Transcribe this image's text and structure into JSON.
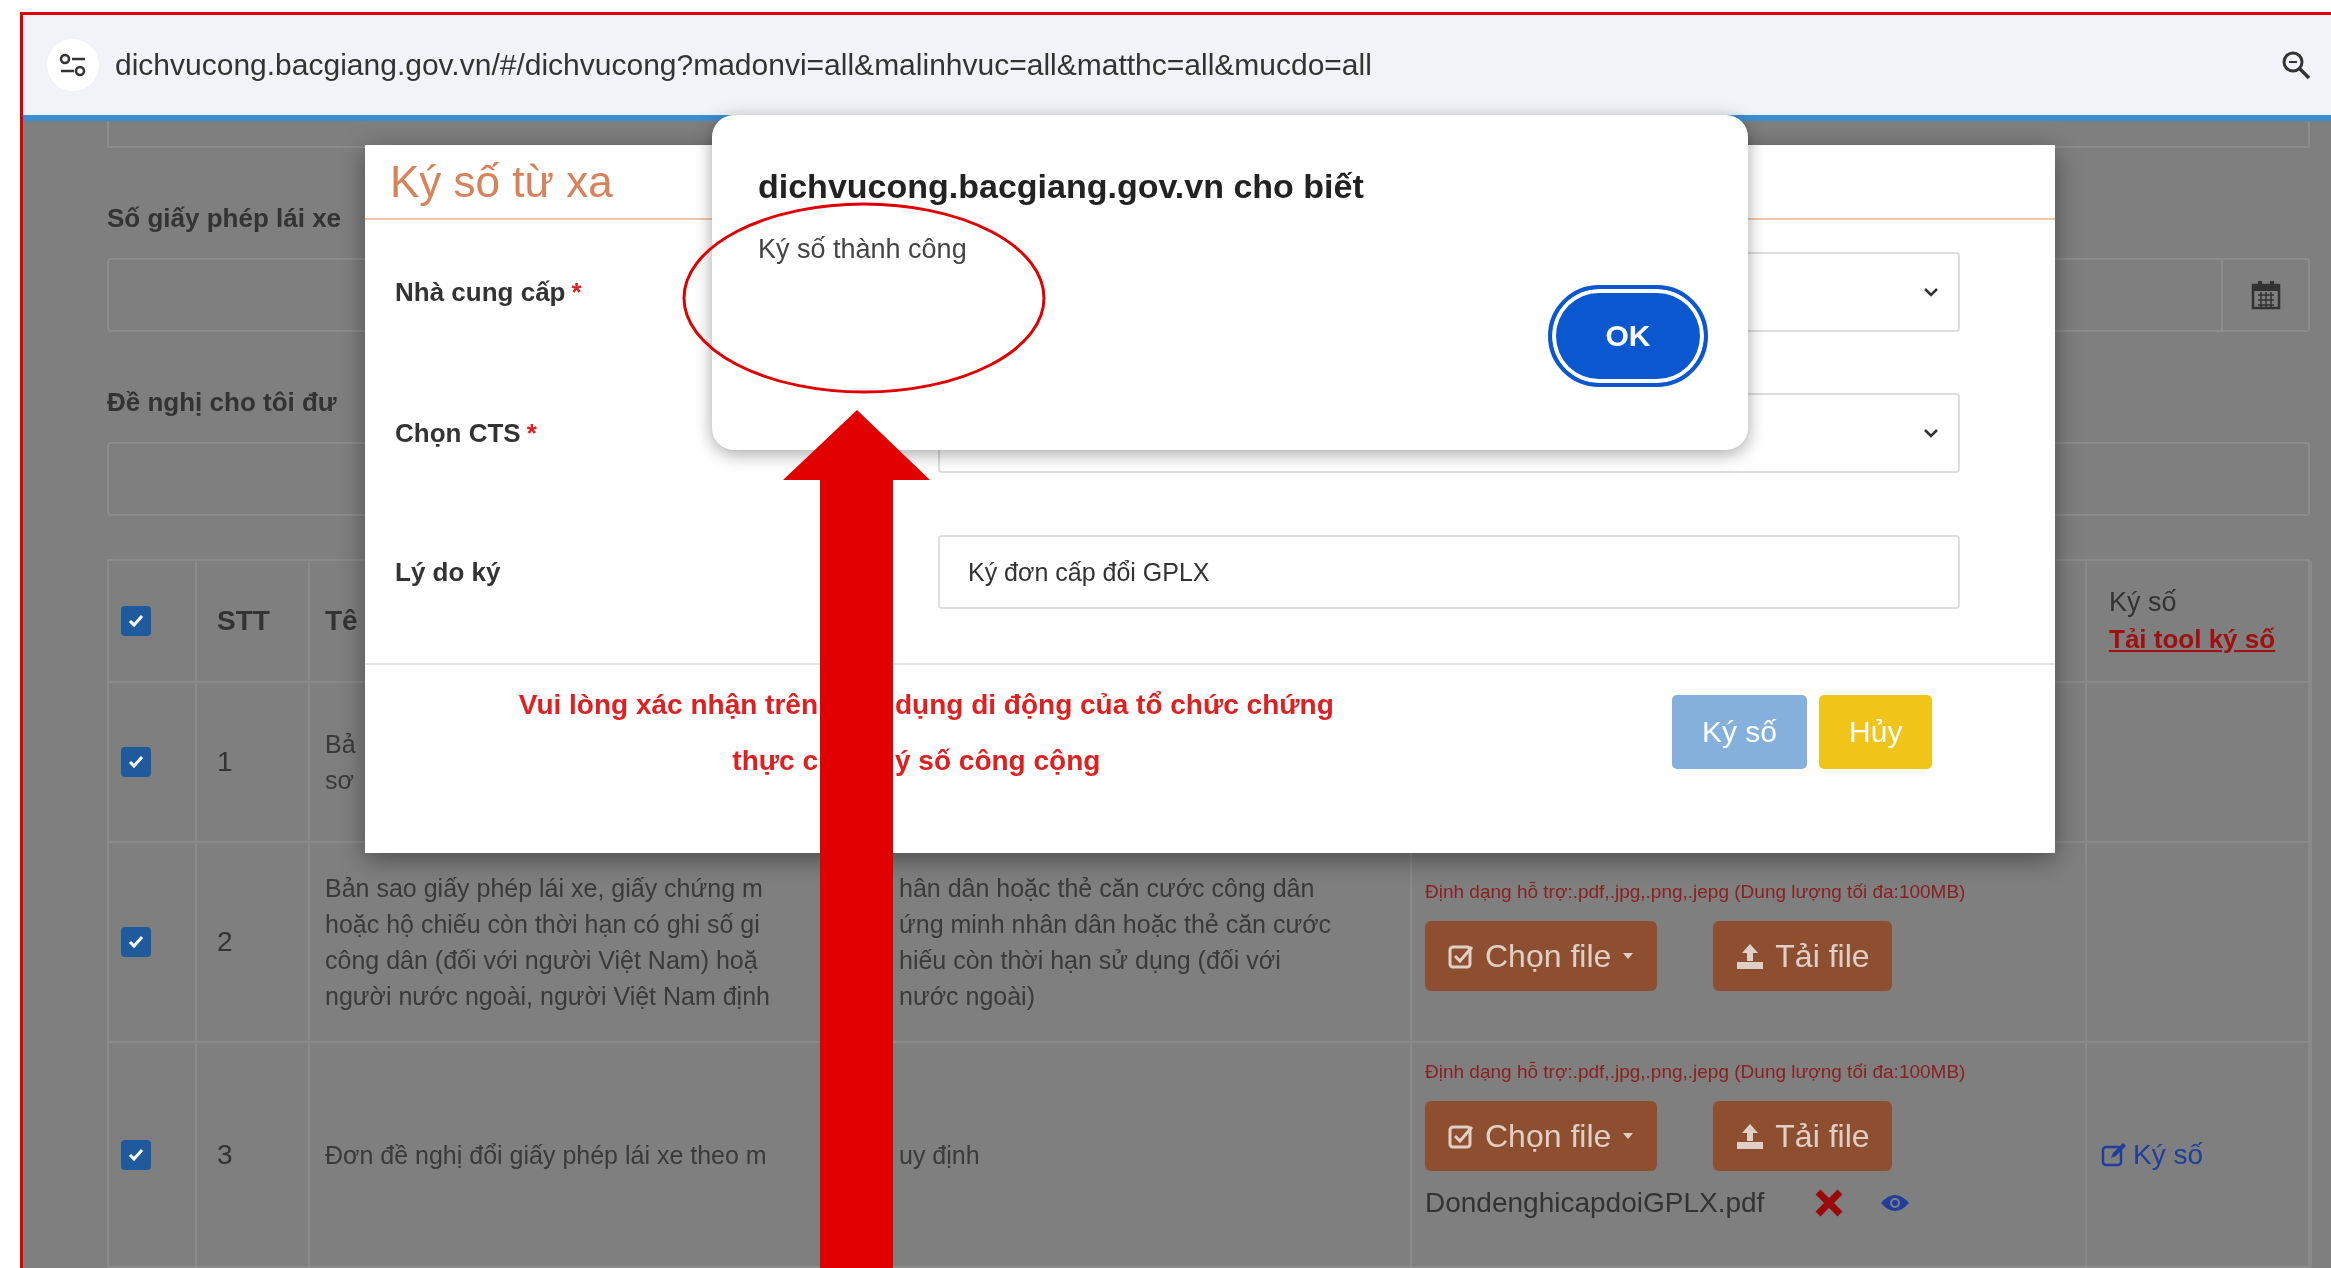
{
  "browser": {
    "url": "dichvucong.bacgiang.gov.vn/#/dichvucong?madonvi=all&malinhvuc=all&matthc=all&mucdo=all"
  },
  "form": {
    "fields": [
      {
        "label": "Số giấy phép lái xe",
        "kind": "date"
      },
      {
        "label": "Đề nghị cho tôi đư",
        "kind": "text"
      }
    ]
  },
  "table": {
    "header": {
      "checked": true,
      "number": "STT",
      "name": "Tê",
      "sign": "Ký số",
      "sign_link": "Tải tool ký số"
    },
    "rows": [
      {
        "checked": true,
        "number": "1",
        "name_lines": [
          [
            "Bả"
          ],
          [
            "sơ"
          ]
        ]
      },
      {
        "checked": true,
        "number": "2",
        "name_lines": [
          [
            "Bản sao giấy phép lái xe, giấy chứng m",
            "hân dân hoặc thẻ căn cước công dân"
          ],
          [
            "hoặc hộ chiếu còn thời hạn có ghi số gi",
            "ứng minh nhân dân hoặc thẻ căn cước"
          ],
          [
            "công dân (đối với người Việt Nam) hoặ",
            "hiếu còn thời hạn sử dụng (đối với"
          ],
          [
            "người nước ngoài, người Việt Nam định",
            "nước ngoài)"
          ]
        ],
        "files": {
          "hint": "Định dạng hỗ trợ:.pdf,.jpg,.png,.jepg (Dung lượng tối đa:100MB)",
          "choose": "Chọn file",
          "upload": "Tải file"
        }
      },
      {
        "checked": true,
        "number": "3",
        "name_lines": [
          [
            "Đơn đề nghị đổi giấy phép lái xe theo m",
            "uy định"
          ]
        ],
        "files": {
          "hint": "Định dạng hỗ trợ:.pdf,.jpg,.png,.jepg (Dung lượng tối đa:100MB)",
          "choose": "Chọn file",
          "upload": "Tải file",
          "file_name": "DondenghicapdoiGPLX.pdf"
        },
        "sign_link": "Ký số"
      }
    ]
  },
  "modal": {
    "title": "Ký số từ xa",
    "fields": [
      {
        "label": "Nhà cung cấp",
        "required_mark": "*",
        "kind": "select"
      },
      {
        "label": "Chọn CTS",
        "required_mark": "*",
        "kind": "select"
      },
      {
        "label": "Lý do ký",
        "kind": "text",
        "value": "Ký đơn cấp đổi GPLX"
      }
    ],
    "note_lines": [
      [
        "Vui lòng xác nhận trên",
        "dụng di động của tổ chức chứng"
      ],
      [
        "thực c",
        "ý số công cộng"
      ]
    ],
    "buttons": [
      {
        "label": "Ký số",
        "kind": "primary"
      },
      {
        "label": "Hủy",
        "kind": "warning"
      }
    ]
  },
  "alert": {
    "title": "dichvucong.bacgiang.gov.vn cho biết",
    "message": "Ký số thành công",
    "button": "OK"
  }
}
